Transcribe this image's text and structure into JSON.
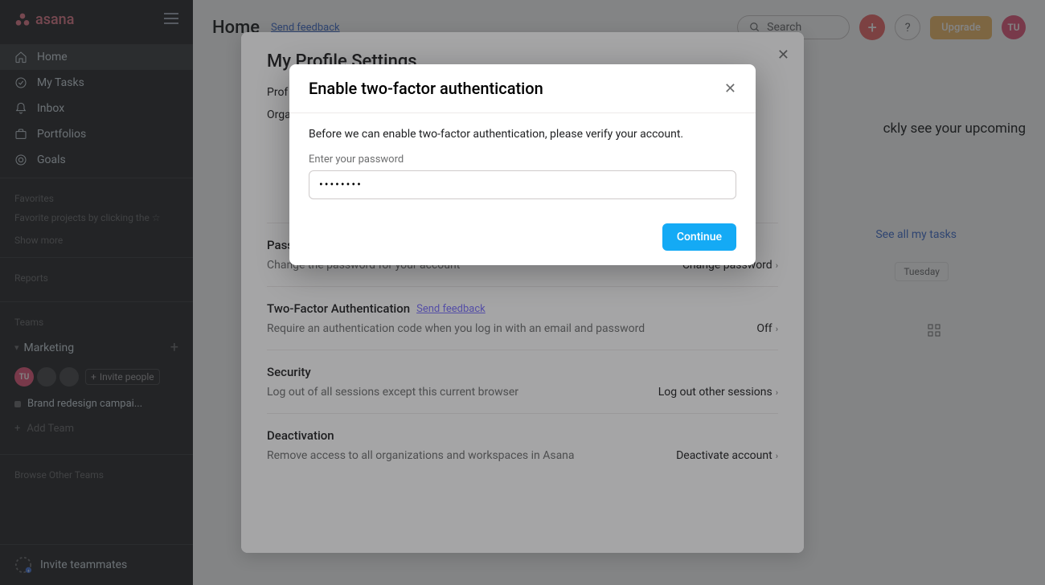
{
  "brand": "asana",
  "sidebar": {
    "nav": [
      {
        "label": "Home"
      },
      {
        "label": "My Tasks"
      },
      {
        "label": "Inbox"
      },
      {
        "label": "Portfolios"
      },
      {
        "label": "Goals"
      }
    ],
    "favorites_label": "Favorites",
    "favorites_hint": "Favorite projects by clicking the ☆",
    "show_more": "Show more",
    "reports_label": "Reports",
    "teams_label": "Teams",
    "team_name": "Marketing",
    "invite_people": "Invite people",
    "project": "Brand redesign campai...",
    "add_team": "Add Team",
    "browse_other": "Browse Other Teams",
    "invite_teammates": "Invite teammates",
    "avatar_initials": "TU"
  },
  "header": {
    "title": "Home",
    "send_feedback": "Send feedback",
    "search_placeholder": "Search",
    "upgrade": "Upgrade",
    "avatar": "TU"
  },
  "bg": {
    "upcoming_hint": "ckly see your upcoming",
    "see_all": "See all my tasks",
    "tuesday": "Tuesday"
  },
  "settings_modal": {
    "title": "My Profile Settings",
    "profile_row": "Prof",
    "org_row": "Orga",
    "sections": {
      "password": {
        "title": "Pass",
        "desc": "Change the password for your account",
        "action": "Change password"
      },
      "tfa": {
        "title": "Two-Factor Authentication",
        "feedback": "Send feedback",
        "desc": "Require an authentication code when you log in with an email and password",
        "action": "Off"
      },
      "security": {
        "title": "Security",
        "desc": "Log out of all sessions except this current browser",
        "action": "Log out other sessions"
      },
      "deactivation": {
        "title": "Deactivation",
        "desc": "Remove access to all organizations and workspaces in Asana",
        "action": "Deactivate account"
      }
    }
  },
  "tfa_modal": {
    "title": "Enable two-factor authentication",
    "subtitle": "Before we can enable two-factor authentication, please verify your account.",
    "password_label": "Enter your password",
    "password_value": "••••••••",
    "continue": "Continue"
  }
}
